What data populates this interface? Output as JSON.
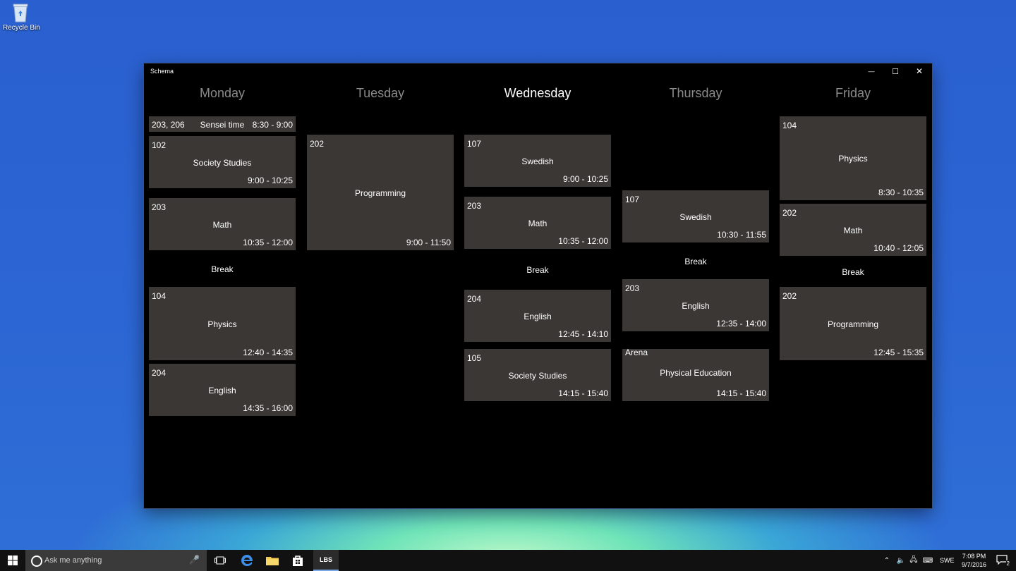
{
  "desktop": {
    "recycle_bin_label": "Recycle Bin"
  },
  "window": {
    "title": "Schema",
    "controls": {
      "minimize": "—",
      "maximize": "☐",
      "close": "✕"
    }
  },
  "days": [
    {
      "name": "Monday",
      "header_slim": {
        "rooms": "203, 206",
        "subject": "Sensei time",
        "time": "8:30 - 9:00"
      },
      "lessons": [
        {
          "room": "102",
          "subject": "Society Studies",
          "time": "9:00 - 10:25"
        },
        {
          "room": "203",
          "subject": "Math",
          "time": "10:35 - 12:00"
        },
        {
          "break": "Break"
        },
        {
          "room": "104",
          "subject": "Physics",
          "time": "12:40 - 14:35"
        },
        {
          "room": "204",
          "subject": "English",
          "time": "14:35 - 16:00"
        }
      ]
    },
    {
      "name": "Tuesday",
      "lessons": [
        {
          "room": "202",
          "subject": "Programming",
          "time": "9:00 - 11:50"
        }
      ]
    },
    {
      "name": "Wednesday",
      "lessons": [
        {
          "room": "107",
          "subject": "Swedish",
          "time": "9:00 - 10:25"
        },
        {
          "room": "203",
          "subject": "Math",
          "time": "10:35 - 12:00"
        },
        {
          "break": "Break"
        },
        {
          "room": "204",
          "subject": "English",
          "time": "12:45 - 14:10"
        },
        {
          "room": "105",
          "subject": "Society Studies",
          "time": "14:15 - 15:40"
        }
      ]
    },
    {
      "name": "Thursday",
      "lessons": [
        {
          "room": "107",
          "subject": "Swedish",
          "time": "10:30 - 11:55"
        },
        {
          "break": "Break"
        },
        {
          "room": "203",
          "subject": "English",
          "time": "12:35 - 14:00"
        },
        {
          "room": "Arena",
          "subject": "Physical Education",
          "time": "14:15 - 15:40"
        }
      ]
    },
    {
      "name": "Friday",
      "lessons": [
        {
          "room": "104",
          "subject": "Physics",
          "time": "8:30 - 10:35"
        },
        {
          "room": "202",
          "subject": "Math",
          "time": "10:40 - 12:05"
        },
        {
          "break": "Break"
        },
        {
          "room": "202",
          "subject": "Programming",
          "time": "12:45 - 15:35"
        }
      ]
    }
  ],
  "taskbar": {
    "search_placeholder": "Ask me anything",
    "active_app_label": "LBS",
    "language": "SWE",
    "time": "7:08 PM",
    "date": "9/7/2016",
    "notification_count": "2"
  },
  "colors": {
    "card": "#3a3734",
    "window_bg": "#000000",
    "inactive_day": "#8a8a8a"
  }
}
